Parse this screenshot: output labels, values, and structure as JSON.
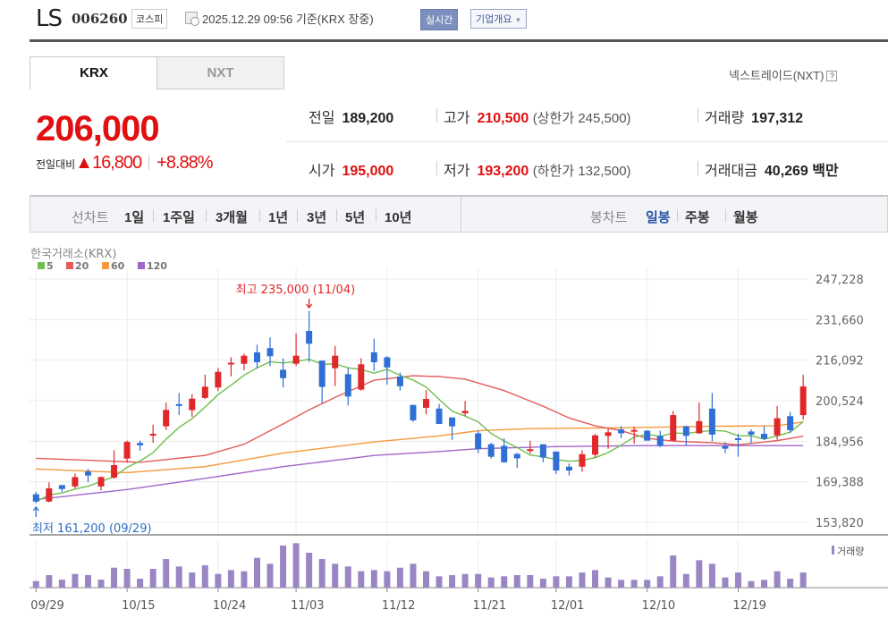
{
  "header": {
    "name": "LS",
    "code": "006260",
    "market": "코스피",
    "timestamp": "2025.12.29 09:56 기준(KRX 장중)",
    "realtime_label": "실시간",
    "company_label": "기업개요"
  },
  "tabs": [
    {
      "label": "KRX",
      "active": true
    },
    {
      "label": "NXT",
      "active": false
    }
  ],
  "nxt_link": "넥스트레이드(NXT)",
  "nxt_help": "?",
  "quote": {
    "price": "206,000",
    "change_label": "전일대비",
    "change": "16,800",
    "change_pct": "+8.88%",
    "prev_label": "전일",
    "prev": "189,200",
    "high_label": "고가",
    "high": "210,500",
    "upper_limit": "(상한가 245,500)",
    "volume_label": "거래량",
    "volume": "197,312",
    "open_label": "시가",
    "open": "195,000",
    "low_label": "저가",
    "low": "193,200",
    "lower_limit": "(하한가 132,500)",
    "value_label": "거래대금",
    "value": "40,269 백만"
  },
  "toolbar": {
    "line_label": "선차트",
    "line_periods": [
      "1일",
      "1주일",
      "3개월",
      "1년",
      "3년",
      "5년",
      "10년"
    ],
    "candle_label": "봉차트",
    "candle_periods": [
      "일봉",
      "주봉",
      "월봉"
    ],
    "candle_selected": "일봉"
  },
  "colors": {
    "up": "#e0282b",
    "down": "#2f6fd6",
    "ma5": "#6fbf4c",
    "ma20": "#e35b5b",
    "ma60": "#f39a3c",
    "ma120": "#a066c8",
    "volume": "#9b86c4"
  },
  "chart_data": {
    "type": "candlestick",
    "exchange_label": "한국거래소(KRX)",
    "legend": [
      "5",
      "20",
      "60",
      "120"
    ],
    "y_ticks": [
      "247,228",
      "231,660",
      "216,092",
      "200,524",
      "184,956",
      "169,388",
      "153,820"
    ],
    "ylim": [
      153820,
      247228
    ],
    "x_ticks": [
      {
        "index": 0,
        "label": "09/29"
      },
      {
        "index": 7,
        "label": "10/15"
      },
      {
        "index": 14,
        "label": "10/24"
      },
      {
        "index": 20,
        "label": "11/03"
      },
      {
        "index": 27,
        "label": "11/12"
      },
      {
        "index": 34,
        "label": "11/21"
      },
      {
        "index": 40,
        "label": "12/01"
      },
      {
        "index": 47,
        "label": "12/10"
      },
      {
        "index": 54,
        "label": "12/19"
      }
    ],
    "high_annotation": {
      "index": 21,
      "text": "최고 235,000 (11/04)"
    },
    "low_annotation": {
      "index": 0,
      "text": "최저 161,200 (09/29)"
    },
    "volume_legend": "거래량",
    "ohlc": [
      [
        164600,
        165500,
        161200,
        161800
      ],
      [
        161800,
        169200,
        161500,
        166900
      ],
      [
        168100,
        168100,
        165500,
        166600
      ],
      [
        167600,
        172600,
        166900,
        171200
      ],
      [
        173300,
        174400,
        169200,
        171800
      ],
      [
        167600,
        171400,
        166100,
        171200
      ],
      [
        171000,
        181500,
        170600,
        175800
      ],
      [
        178300,
        185200,
        176700,
        184700
      ],
      [
        184300,
        185200,
        181300,
        183400
      ],
      [
        187200,
        191300,
        184400,
        187800
      ],
      [
        190700,
        199800,
        189300,
        197000
      ],
      [
        199200,
        203500,
        195000,
        198500
      ],
      [
        196900,
        203000,
        194300,
        201300
      ],
      [
        201600,
        210600,
        201200,
        205900
      ],
      [
        205600,
        213100,
        204200,
        211600
      ],
      [
        214500,
        217200,
        209900,
        215100
      ],
      [
        214700,
        218600,
        212200,
        217800
      ],
      [
        219100,
        222000,
        213000,
        215300
      ],
      [
        220700,
        224800,
        213800,
        217600
      ],
      [
        212400,
        216800,
        205600,
        209200
      ],
      [
        214700,
        226400,
        213800,
        217800
      ],
      [
        227300,
        235000,
        215300,
        222400
      ],
      [
        215900,
        215900,
        199600,
        205800
      ],
      [
        213000,
        221600,
        206100,
        217800
      ],
      [
        210700,
        213000,
        198700,
        202100
      ],
      [
        204800,
        216800,
        204400,
        214500
      ],
      [
        219100,
        224400,
        211900,
        215300
      ],
      [
        217200,
        217600,
        206700,
        213300
      ],
      [
        209800,
        211300,
        204400,
        206100
      ],
      [
        198900,
        198900,
        192400,
        193000
      ],
      [
        197800,
        204600,
        195300,
        201200
      ],
      [
        197500,
        199300,
        191600,
        191600
      ],
      [
        194100,
        194100,
        185500,
        190700
      ],
      [
        195700,
        200400,
        194700,
        196600
      ],
      [
        188000,
        189000,
        180400,
        181900
      ],
      [
        183800,
        184400,
        178300,
        179000
      ],
      [
        183200,
        186100,
        176700,
        176900
      ],
      [
        180100,
        180400,
        174700,
        178400
      ],
      [
        181200,
        185200,
        180100,
        181900
      ],
      [
        183800,
        183800,
        176900,
        178700
      ],
      [
        181000,
        181000,
        172400,
        173700
      ],
      [
        175200,
        176400,
        171800,
        173700
      ],
      [
        175200,
        181500,
        173300,
        180000
      ],
      [
        179800,
        187800,
        178700,
        187200
      ],
      [
        187000,
        189800,
        182100,
        188400
      ],
      [
        189500,
        190700,
        186100,
        188000
      ],
      [
        188700,
        190500,
        184000,
        189300
      ],
      [
        189000,
        189200,
        185200,
        185200
      ],
      [
        187000,
        189000,
        182700,
        183200
      ],
      [
        185200,
        196600,
        185200,
        195000
      ],
      [
        190700,
        190900,
        183200,
        187000
      ],
      [
        188000,
        199800,
        187800,
        192700
      ],
      [
        197500,
        203500,
        185000,
        187500
      ],
      [
        183100,
        184600,
        180400,
        182100
      ],
      [
        186100,
        187800,
        179000,
        185800
      ],
      [
        188700,
        189500,
        184000,
        187500
      ],
      [
        187800,
        190700,
        185500,
        185900
      ],
      [
        187200,
        198500,
        185500,
        193800
      ],
      [
        194600,
        196200,
        188200,
        189200
      ],
      [
        195000,
        210500,
        193200,
        206000
      ]
    ],
    "volume_thousands": [
      85,
      163,
      104,
      178,
      163,
      104,
      259,
      244,
      116,
      244,
      371,
      275,
      197,
      290,
      178,
      228,
      213,
      387,
      310,
      546,
      577,
      453,
      371,
      310,
      275,
      213,
      228,
      213,
      259,
      310,
      213,
      147,
      163,
      178,
      178,
      132,
      147,
      163,
      163,
      116,
      147,
      147,
      197,
      228,
      132,
      101,
      101,
      101,
      147,
      418,
      178,
      356,
      310,
      132,
      197,
      85,
      101,
      213,
      116,
      197
    ],
    "ma20_points": [
      [
        0,
        178400
      ],
      [
        8,
        176900
      ],
      [
        13,
        179500
      ],
      [
        16,
        183800
      ],
      [
        19,
        191600
      ],
      [
        21,
        197000
      ],
      [
        23,
        201800
      ],
      [
        26,
        208400
      ],
      [
        29,
        210100
      ],
      [
        31,
        209800
      ],
      [
        33,
        208800
      ],
      [
        36,
        204400
      ],
      [
        39,
        198400
      ],
      [
        41,
        193900
      ],
      [
        43,
        190900
      ],
      [
        45,
        189000
      ],
      [
        47,
        186100
      ],
      [
        49,
        185000
      ],
      [
        52,
        184400
      ],
      [
        54,
        183600
      ],
      [
        57,
        185200
      ],
      [
        59,
        186900
      ]
    ],
    "ma60_points": [
      [
        0,
        174300
      ],
      [
        7,
        172900
      ],
      [
        13,
        175200
      ],
      [
        19,
        180400
      ],
      [
        26,
        184700
      ],
      [
        31,
        187000
      ],
      [
        34,
        189000
      ],
      [
        38,
        189800
      ],
      [
        45,
        190100
      ],
      [
        52,
        190700
      ],
      [
        57,
        190900
      ],
      [
        59,
        192400
      ]
    ],
    "ma120_points": [
      [
        0,
        162600
      ],
      [
        7,
        166400
      ],
      [
        13,
        170700
      ],
      [
        19,
        175200
      ],
      [
        26,
        179500
      ],
      [
        31,
        181000
      ],
      [
        34,
        182100
      ],
      [
        40,
        182900
      ],
      [
        47,
        183300
      ],
      [
        59,
        183300
      ]
    ]
  }
}
